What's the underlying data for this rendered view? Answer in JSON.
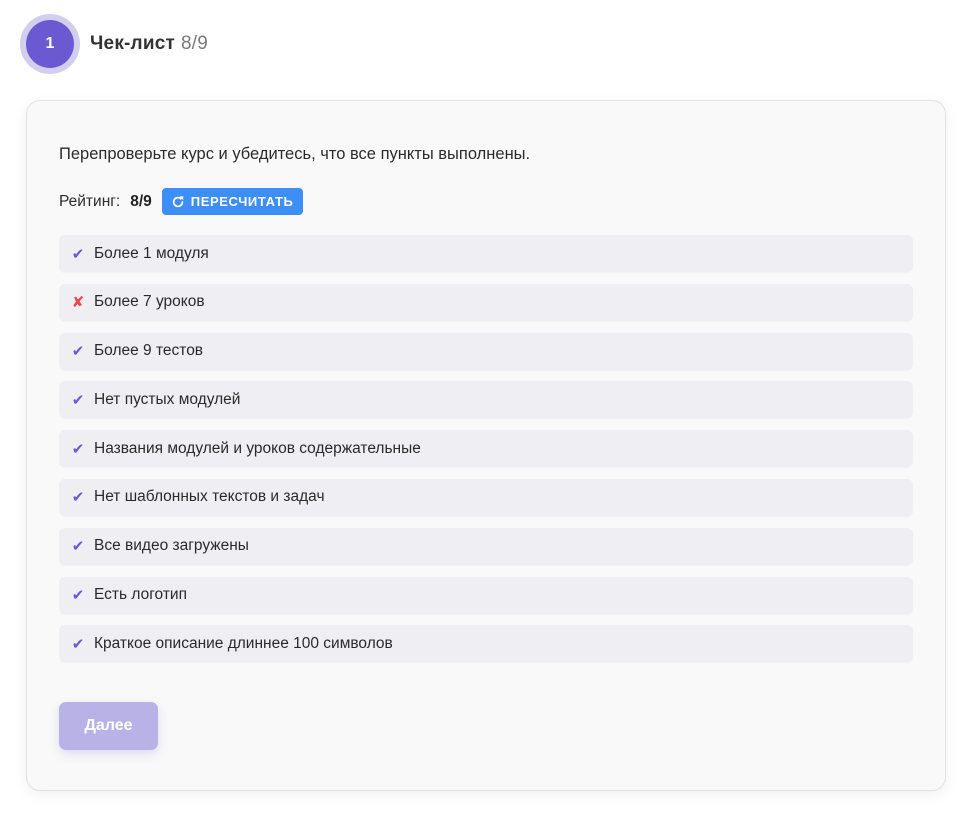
{
  "colors": {
    "accent": "#6a59d1",
    "button_blue": "#3d8ef7",
    "fail": "#f0474d",
    "next_disabled": "#b9b2e7"
  },
  "step": {
    "number": "1",
    "title": "Чек-лист",
    "progress": "8/9"
  },
  "instruction": "Перепроверьте курс и убедитесь, что все пункты выполнены.",
  "rating": {
    "label": "Рейтинг:",
    "value": "8/9",
    "recalc_label": "ПЕРЕСЧИТАТЬ",
    "recalc_icon": "refresh-icon"
  },
  "checklist": [
    {
      "label": "Более 1 модуля",
      "status": "pass",
      "mark": "✔"
    },
    {
      "label": "Более 7 уроков",
      "status": "fail",
      "mark": "✘"
    },
    {
      "label": "Более 9 тестов",
      "status": "pass",
      "mark": "✔"
    },
    {
      "label": "Нет пустых модулей",
      "status": "pass",
      "mark": "✔"
    },
    {
      "label": "Названия модулей и уроков содержательные",
      "status": "pass",
      "mark": "✔"
    },
    {
      "label": "Нет шаблонных текстов и задач",
      "status": "pass",
      "mark": "✔"
    },
    {
      "label": "Все видео загружены",
      "status": "pass",
      "mark": "✔"
    },
    {
      "label": "Есть логотип",
      "status": "pass",
      "mark": "✔"
    },
    {
      "label": "Краткое описание длиннее 100 символов",
      "status": "pass",
      "mark": "✔"
    }
  ],
  "next_label": "Далее"
}
